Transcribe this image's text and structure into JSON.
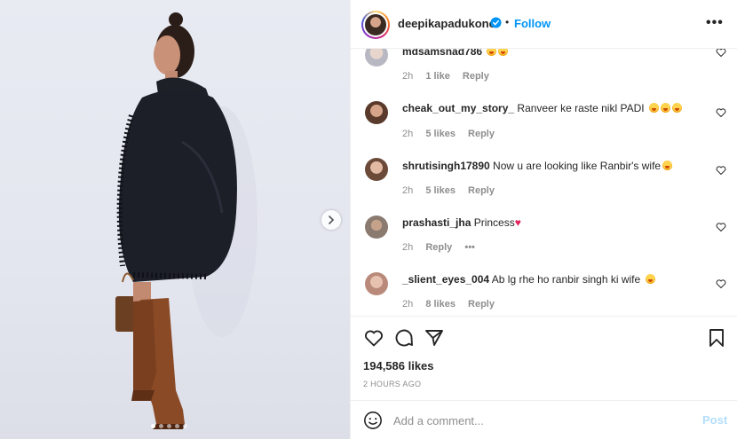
{
  "post": {
    "username": "deepikapadukone",
    "follow_label": "Follow",
    "more_label": "•••",
    "separator": "•"
  },
  "comments": [
    {
      "username": "mdsamsnad786",
      "text": "",
      "emojis": 2,
      "time": "2h",
      "likes": "1 like",
      "reply": "Reply"
    },
    {
      "username": "cheak_out_my_story_",
      "text": "Ranveer ke raste nikl PADI",
      "emojis": 3,
      "time": "2h",
      "likes": "5 likes",
      "reply": "Reply"
    },
    {
      "username": "shrutisingh17890",
      "text": "Now u are looking like Ranbir's wife",
      "emojis": 1,
      "time": "2h",
      "likes": "5 likes",
      "reply": "Reply"
    },
    {
      "username": "prashasti_jha",
      "text": "Princess",
      "heart": "♥",
      "time": "2h",
      "reply": "Reply",
      "more": "•••"
    },
    {
      "username": "_slient_eyes_004",
      "text": "Ab lg rhe ho ranbir singh ki wife",
      "emojis": 1,
      "time": "2h",
      "likes": "8 likes",
      "reply": "Reply"
    }
  ],
  "actions": {
    "likes_count": "194,586 likes",
    "time_ago": "2 HOURS AGO"
  },
  "composer": {
    "placeholder": "Add a comment...",
    "post_label": "Post"
  },
  "colors": {
    "accent": "#0095f6",
    "post_disabled": "#b2dffc",
    "muted": "#8e8e8e",
    "text": "#262626"
  },
  "icons": [
    "chevron-right-icon",
    "verified-badge-icon",
    "heart-icon",
    "comment-icon",
    "share-icon",
    "bookmark-icon",
    "emoji-icon"
  ]
}
